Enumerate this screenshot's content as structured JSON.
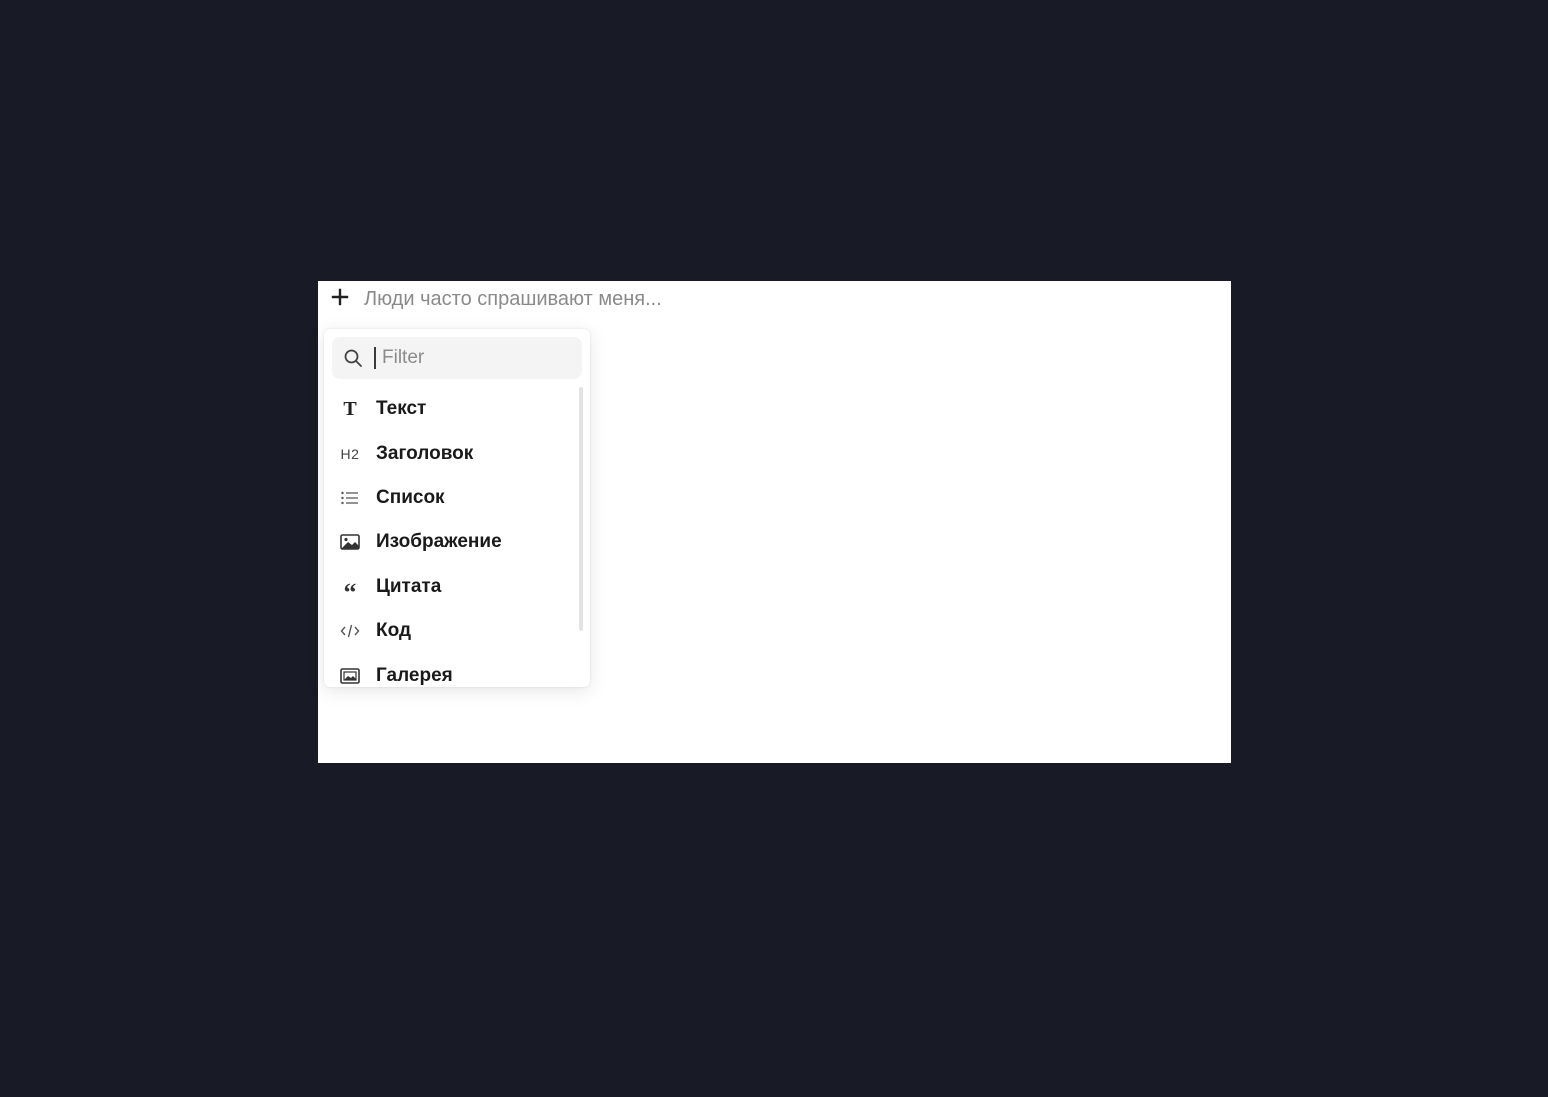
{
  "editor": {
    "placeholder": "Люди часто спрашивают меня...",
    "add_icon": "plus-icon"
  },
  "menu": {
    "filter_placeholder": "Filter",
    "filter_value": "",
    "search_icon": "search-icon",
    "items": [
      {
        "label": "Текст",
        "icon": "text-icon"
      },
      {
        "label": "Заголовок",
        "icon": "heading-icon",
        "glyph": "H2"
      },
      {
        "label": "Список",
        "icon": "list-icon"
      },
      {
        "label": "Изображение",
        "icon": "image-icon"
      },
      {
        "label": "Цитата",
        "icon": "quote-icon"
      },
      {
        "label": "Код",
        "icon": "code-icon"
      },
      {
        "label": "Галерея",
        "icon": "gallery-icon"
      }
    ]
  },
  "colors": {
    "background": "#181a25",
    "surface": "#ffffff",
    "filter_bg": "#f4f4f5",
    "text": "#1a1a1a",
    "placeholder": "#8a8a8a"
  }
}
